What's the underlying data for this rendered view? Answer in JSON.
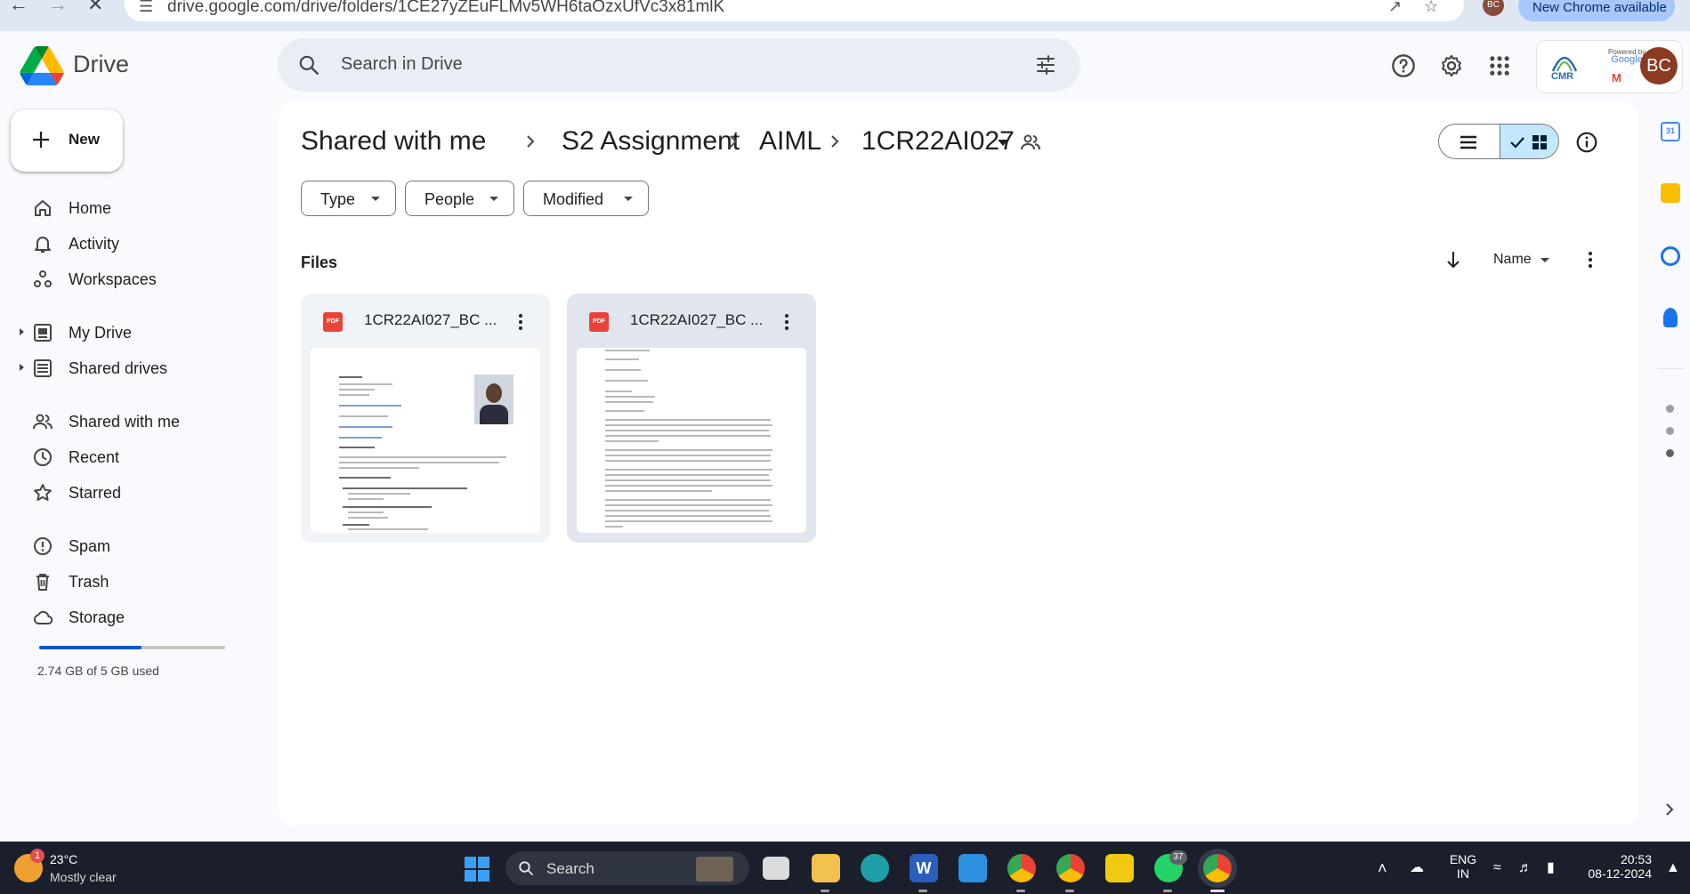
{
  "browser": {
    "url": "drive.google.com/drive/folders/1CE27yZEuFLMv5WH6taOzxUfVc3x81mlK",
    "profile_initials": "BC",
    "chrome_update_label": "New Chrome available"
  },
  "header": {
    "app_name": "Drive",
    "search_placeholder": "Search in Drive",
    "avatar_initials": "BC",
    "org_badge": {
      "powered_by": "Powered by",
      "brand": "Google",
      "org": "CMR"
    }
  },
  "sidebar": {
    "new_label": "New",
    "items": [
      {
        "label": "Home",
        "icon": "home-icon"
      },
      {
        "label": "Activity",
        "icon": "bell-icon"
      },
      {
        "label": "Workspaces",
        "icon": "workspaces-icon"
      },
      {
        "label": "My Drive",
        "icon": "my-drive-icon"
      },
      {
        "label": "Shared drives",
        "icon": "shared-drives-icon"
      },
      {
        "label": "Shared with me",
        "icon": "people-icon"
      },
      {
        "label": "Recent",
        "icon": "clock-icon"
      },
      {
        "label": "Starred",
        "icon": "star-icon"
      },
      {
        "label": "Spam",
        "icon": "spam-icon"
      },
      {
        "label": "Trash",
        "icon": "trash-icon"
      },
      {
        "label": "Storage",
        "icon": "cloud-icon"
      }
    ],
    "storage": {
      "used_text": "2.74 GB of 5 GB used",
      "used_fraction": 0.548
    }
  },
  "main": {
    "breadcrumbs": [
      "Shared with me",
      "S2 Assignment",
      "AIML",
      "1CR22AI027"
    ],
    "filters": [
      "Type",
      "People",
      "Modified"
    ],
    "section_title": "Files",
    "sort_label": "Name",
    "files": [
      {
        "name": "1CR22AI027_BC ...",
        "type_badge": "PDF",
        "preview": "resume"
      },
      {
        "name": "1CR22AI027_BC ...",
        "type_badge": "PDF",
        "preview": "letter"
      }
    ]
  },
  "taskbar": {
    "weather_temp": "23°C",
    "weather_desc": "Mostly clear",
    "weather_badge": "1",
    "search_label": "Search",
    "whatsapp_badge": "37",
    "lang_top": "ENG",
    "lang_bottom": "IN",
    "time": "20:53",
    "date": "08-12-2024"
  },
  "colors": {
    "accent": "#0b57d0",
    "selected_view": "#c2e7ff",
    "pdf_red": "#ea4335",
    "page_bg": "#f8fafd",
    "taskbar_bg": "#1a1f2b"
  }
}
